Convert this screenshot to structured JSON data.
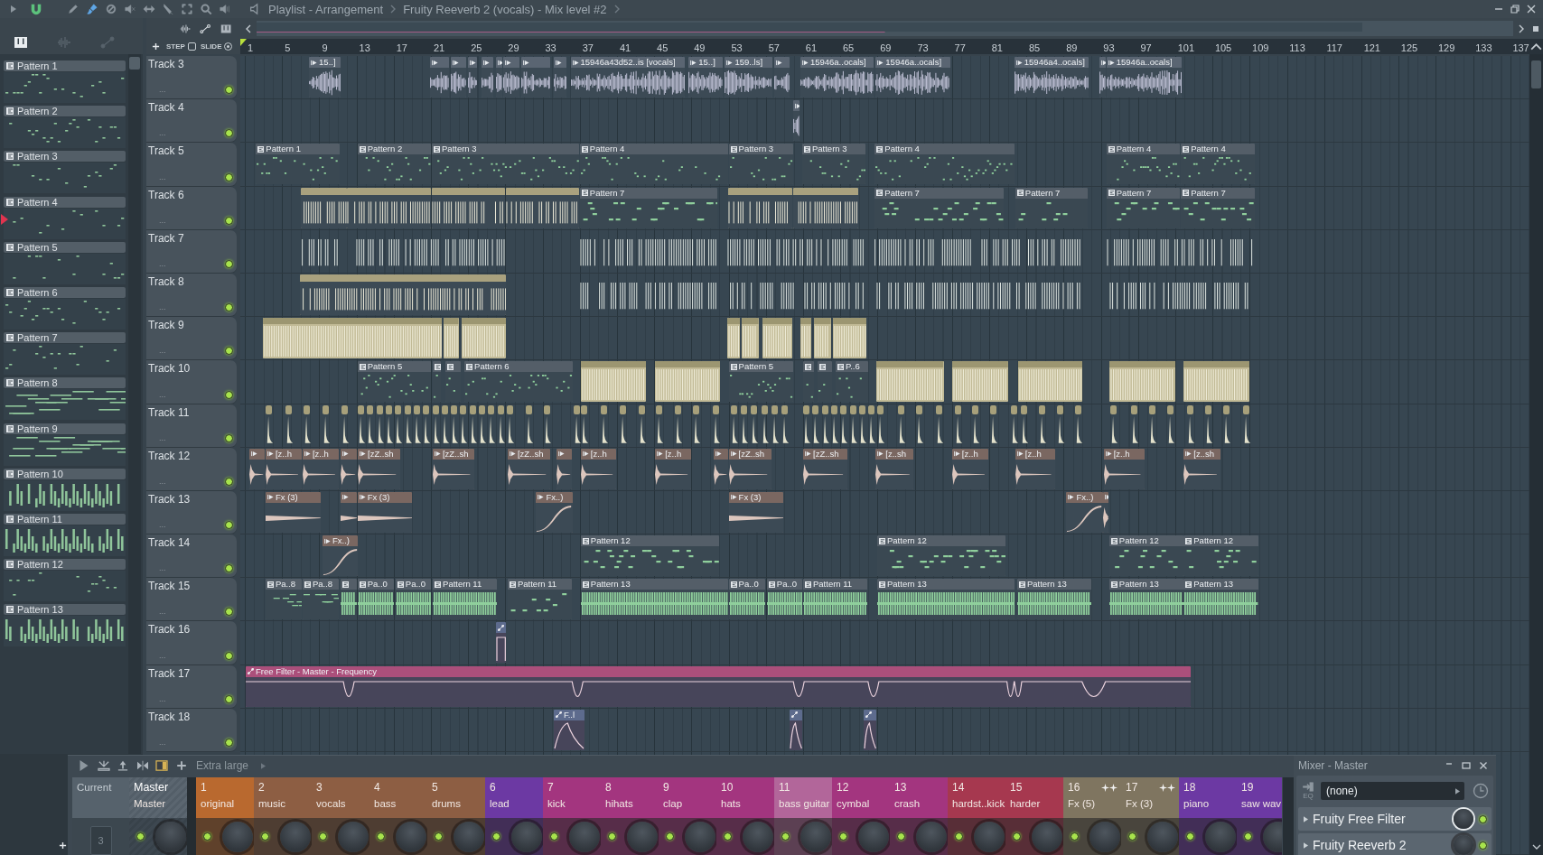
{
  "title_bar": {
    "snap": {
      "on": true
    },
    "tools": [
      {
        "selected": false
      },
      {
        "selected": true
      },
      {
        "selected": false
      },
      {
        "selected": false
      },
      {
        "selected": false
      },
      {
        "selected": false
      },
      {
        "selected": false
      },
      {
        "selected": false
      },
      {
        "selected": false
      }
    ],
    "breadcrumbs": [
      "Playlist - Arrangement",
      "Fruity Reeverb 2 (vocals) - Mix level #2"
    ]
  },
  "browser": {
    "filters": [
      {
        "selected": true
      },
      {
        "selected": false
      },
      {
        "selected": false
      }
    ],
    "patterns": [
      {
        "name": "Pattern 1",
        "selected": false
      },
      {
        "name": "Pattern 2",
        "selected": false
      },
      {
        "name": "Pattern 3",
        "selected": false
      },
      {
        "name": "Pattern 4",
        "selected": true
      },
      {
        "name": "Pattern 5",
        "selected": false
      },
      {
        "name": "Pattern 6",
        "selected": false
      },
      {
        "name": "Pattern 7",
        "selected": false
      },
      {
        "name": "Pattern 8",
        "selected": false
      },
      {
        "name": "Pattern 9",
        "selected": false
      },
      {
        "name": "Pattern 10",
        "selected": false
      },
      {
        "name": "Pattern 11",
        "selected": false
      },
      {
        "name": "Pattern 12",
        "selected": false
      },
      {
        "name": "Pattern 13",
        "selected": false
      }
    ]
  },
  "playlist": {
    "step": {
      "label": "STEP",
      "on": false
    },
    "slide": {
      "label": "SLIDE",
      "on": true
    },
    "ruler": [
      "1",
      "5",
      "9",
      "13",
      "17",
      "21",
      "25",
      "29",
      "33",
      "37",
      "41",
      "45",
      "49",
      "53",
      "57",
      "61",
      "65",
      "69",
      "73",
      "77",
      "81",
      "85",
      "89",
      "93",
      "97",
      "101",
      "105",
      "109",
      "113",
      "117",
      "121",
      "125",
      "129",
      "133",
      "137"
    ],
    "tracks": [
      {
        "name": "Track 3",
        "more": "...",
        "on": true,
        "clips": [
          {
            "kind": "audio",
            "label": "15..]"
          },
          {
            "kind": "audio"
          },
          {
            "kind": "audio"
          },
          {
            "kind": "audio"
          },
          {
            "kind": "audio"
          },
          {
            "kind": "audio"
          },
          {
            "kind": "audio"
          },
          {
            "kind": "audio"
          },
          {
            "kind": "audio"
          },
          {
            "kind": "audio",
            "label": "15946a43d52..is [vocals]"
          },
          {
            "kind": "audio",
            "label": "15..]"
          },
          {
            "kind": "audio",
            "label": "159..ls]"
          },
          {
            "kind": "audio"
          },
          {
            "kind": "audio",
            "label": "15946a..ocals]"
          },
          {
            "kind": "audio",
            "label": "15946a..ocals]"
          },
          {
            "kind": "audio",
            "label": "15946a4..ocals]"
          },
          {
            "kind": "audio"
          },
          {
            "kind": "audio",
            "label": "15946a..ocals]"
          }
        ]
      },
      {
        "name": "Track 4",
        "more": "...",
        "on": true,
        "clips": [
          {
            "kind": "audio"
          }
        ]
      },
      {
        "name": "Track 5",
        "more": "...",
        "on": true,
        "clips": [
          {
            "kind": "pattern",
            "label": "Pattern 1"
          },
          {
            "kind": "pattern",
            "label": "Pattern 2"
          },
          {
            "kind": "pattern",
            "label": "Pattern 3"
          },
          {
            "kind": "pattern",
            "label": "Pattern 4"
          },
          {
            "kind": "pattern",
            "label": "Pattern 3"
          },
          {
            "kind": "pattern",
            "label": "Pattern 3"
          },
          {
            "kind": "pattern",
            "label": "Pattern 4"
          },
          {
            "kind": "pattern",
            "label": "Pattern 4"
          },
          {
            "kind": "pattern",
            "label": "Pattern 4"
          }
        ]
      },
      {
        "name": "Track 6",
        "more": "...",
        "on": true,
        "clips": [
          {
            "kind": "beat"
          },
          {
            "kind": "beat"
          },
          {
            "kind": "beat"
          },
          {
            "kind": "beat"
          },
          {
            "kind": "pattern",
            "label": "Pattern 7"
          },
          {
            "kind": "beat"
          },
          {
            "kind": "beat"
          },
          {
            "kind": "pattern",
            "label": "Pattern 7"
          },
          {
            "kind": "pattern",
            "label": "Pattern 7"
          },
          {
            "kind": "pattern",
            "label": "Pattern 7"
          },
          {
            "kind": "pattern",
            "label": "Pattern 7"
          }
        ]
      },
      {
        "name": "Track 7",
        "more": "...",
        "on": true,
        "clips": [
          {
            "kind": "hits"
          },
          {
            "kind": "hits"
          },
          {
            "kind": "hits"
          },
          {
            "kind": "hits"
          },
          {
            "kind": "hits"
          },
          {
            "kind": "hits"
          },
          {
            "kind": "hits"
          }
        ]
      },
      {
        "name": "Track 8",
        "more": "...",
        "on": true,
        "clips": [
          {
            "kind": "beat"
          },
          {
            "kind": "hits"
          },
          {
            "kind": "hits"
          },
          {
            "kind": "hits"
          },
          {
            "kind": "hits"
          }
        ]
      },
      {
        "name": "Track 9",
        "more": "...",
        "on": true,
        "clips": [
          {
            "kind": "block"
          },
          {
            "kind": "block"
          },
          {
            "kind": "block"
          },
          {
            "kind": "block"
          },
          {
            "kind": "block"
          },
          {
            "kind": "block"
          },
          {
            "kind": "block"
          },
          {
            "kind": "block"
          },
          {
            "kind": "block"
          }
        ]
      },
      {
        "name": "Track 10",
        "more": "...",
        "on": true,
        "clips": [
          {
            "kind": "pattern",
            "label": "Pattern 5"
          },
          {
            "kind": "pattern"
          },
          {
            "kind": "pattern"
          },
          {
            "kind": "pattern",
            "label": "Pattern 6"
          },
          {
            "kind": "block"
          },
          {
            "kind": "block"
          },
          {
            "kind": "pattern",
            "label": "Pattern 5"
          },
          {
            "kind": "pattern"
          },
          {
            "kind": "pattern"
          },
          {
            "kind": "pattern",
            "label": "P..6"
          },
          {
            "kind": "block"
          },
          {
            "kind": "block"
          },
          {
            "kind": "block"
          },
          {
            "kind": "block"
          },
          {
            "kind": "block"
          }
        ]
      },
      {
        "name": "Track 11",
        "more": "...",
        "on": true,
        "clips": [
          {
            "kind": "kick"
          },
          {
            "kind": "kick"
          },
          {
            "kind": "kick"
          },
          {
            "kind": "kick"
          },
          {
            "kind": "kick"
          },
          {
            "kind": "kick"
          },
          {
            "kind": "kick"
          },
          {
            "kind": "kick"
          },
          {
            "kind": "kick"
          },
          {
            "kind": "kick"
          },
          {
            "kind": "kick"
          },
          {
            "kind": "kick"
          },
          {
            "kind": "kick"
          },
          {
            "kind": "kick"
          },
          {
            "kind": "kick"
          },
          {
            "kind": "kick"
          },
          {
            "kind": "kick"
          },
          {
            "kind": "kick"
          },
          {
            "kind": "kick"
          },
          {
            "kind": "kick"
          },
          {
            "kind": "kick"
          },
          {
            "kind": "kick"
          },
          {
            "kind": "kick"
          },
          {
            "kind": "kick"
          },
          {
            "kind": "kick"
          },
          {
            "kind": "kick"
          },
          {
            "kind": "kick"
          },
          {
            "kind": "kick"
          },
          {
            "kind": "kick"
          },
          {
            "kind": "kick"
          },
          {
            "kind": "kick"
          },
          {
            "kind": "kick"
          },
          {
            "kind": "kick"
          },
          {
            "kind": "kick"
          },
          {
            "kind": "kick"
          },
          {
            "kind": "kick"
          },
          {
            "kind": "kick"
          },
          {
            "kind": "kick"
          },
          {
            "kind": "kick"
          },
          {
            "kind": "kick"
          },
          {
            "kind": "kick"
          },
          {
            "kind": "kick"
          },
          {
            "kind": "kick"
          },
          {
            "kind": "kick"
          },
          {
            "kind": "kick"
          },
          {
            "kind": "kick"
          },
          {
            "kind": "kick"
          },
          {
            "kind": "kick"
          },
          {
            "kind": "kick"
          },
          {
            "kind": "kick"
          },
          {
            "kind": "kick"
          },
          {
            "kind": "kick"
          },
          {
            "kind": "kick"
          },
          {
            "kind": "kick"
          },
          {
            "kind": "kick"
          },
          {
            "kind": "kick"
          },
          {
            "kind": "kick"
          },
          {
            "kind": "kick"
          },
          {
            "kind": "kick"
          },
          {
            "kind": "kick"
          },
          {
            "kind": "kick"
          },
          {
            "kind": "kick"
          },
          {
            "kind": "kick"
          },
          {
            "kind": "kick"
          },
          {
            "kind": "kick"
          },
          {
            "kind": "kick"
          },
          {
            "kind": "kick"
          }
        ]
      },
      {
        "name": "Track 12",
        "more": "...",
        "on": true,
        "clips": [
          {
            "kind": "oneshot"
          },
          {
            "kind": "oneshot",
            "label": "[z..h"
          },
          {
            "kind": "oneshot",
            "label": "[z..h"
          },
          {
            "kind": "oneshot"
          },
          {
            "kind": "oneshot",
            "label": "[zZ..sh"
          },
          {
            "kind": "oneshot",
            "label": "[zZ..sh"
          },
          {
            "kind": "oneshot",
            "label": "[zZ..sh"
          },
          {
            "kind": "oneshot"
          },
          {
            "kind": "oneshot",
            "label": "[z..h"
          },
          {
            "kind": "oneshot",
            "label": "[z..h"
          },
          {
            "kind": "oneshot"
          },
          {
            "kind": "oneshot",
            "label": "[zZ..sh"
          },
          {
            "kind": "oneshot",
            "label": "[zZ..sh"
          },
          {
            "kind": "oneshot",
            "label": "[z..sh"
          },
          {
            "kind": "oneshot",
            "label": "[z..h"
          },
          {
            "kind": "oneshot",
            "label": "[z..h"
          },
          {
            "kind": "oneshot",
            "label": "[z..h"
          },
          {
            "kind": "oneshot",
            "label": "[z..sh"
          }
        ]
      },
      {
        "name": "Track 13",
        "more": "...",
        "on": true,
        "clips": [
          {
            "kind": "oneshot",
            "label": "Fx (3)"
          },
          {
            "kind": "oneshot"
          },
          {
            "kind": "oneshot",
            "label": "Fx (3)"
          },
          {
            "kind": "oneshot",
            "label": "Fx..)"
          },
          {
            "kind": "oneshot",
            "label": "Fx (3)"
          },
          {
            "kind": "oneshot",
            "label": "Fx..)"
          },
          {
            "kind": "oneshot"
          }
        ]
      },
      {
        "name": "Track 14",
        "more": "...",
        "on": true,
        "clips": [
          {
            "kind": "oneshot",
            "label": "Fx..)"
          },
          {
            "kind": "pattern",
            "label": "Pattern 12"
          },
          {
            "kind": "pattern",
            "label": "Pattern 12"
          },
          {
            "kind": "pattern",
            "label": "Pattern 12"
          },
          {
            "kind": "pattern",
            "label": "Pattern 12"
          }
        ]
      },
      {
        "name": "Track 15",
        "more": "...",
        "on": true,
        "clips": [
          {
            "kind": "pattern",
            "label": "Pa..8"
          },
          {
            "kind": "pattern",
            "label": "Pa..8"
          },
          {
            "kind": "pattern"
          },
          {
            "kind": "pattern",
            "label": "Pa..0"
          },
          {
            "kind": "pattern",
            "label": "Pa..0"
          },
          {
            "kind": "pattern",
            "label": "Pattern 11"
          },
          {
            "kind": "pattern",
            "label": "Pattern 11"
          },
          {
            "kind": "pattern",
            "label": "Pattern 13"
          },
          {
            "kind": "pattern",
            "label": "Pa..0"
          },
          {
            "kind": "pattern",
            "label": "Pa..0"
          },
          {
            "kind": "pattern",
            "label": "Pattern 11"
          },
          {
            "kind": "pattern",
            "label": "Pattern 13"
          },
          {
            "kind": "pattern",
            "label": "Pattern 13"
          },
          {
            "kind": "pattern",
            "label": "Pattern 13"
          },
          {
            "kind": "pattern",
            "label": "Pattern 13"
          }
        ]
      },
      {
        "name": "Track 16",
        "more": "...",
        "on": true,
        "clips": [
          {
            "kind": "automation",
            "color": "#5d6b8d"
          }
        ]
      },
      {
        "name": "Track 17",
        "more": "...",
        "on": true,
        "clips": [
          {
            "kind": "automation",
            "color": "#ab4f7b",
            "label": "Free Filter - Master - Frequency"
          }
        ]
      },
      {
        "name": "Track 18",
        "more": "...",
        "on": true,
        "clips": [
          {
            "kind": "automation",
            "color": "#5d6b8d",
            "label": "F..l"
          },
          {
            "kind": "automation",
            "color": "#5d6b8d"
          },
          {
            "kind": "automation",
            "color": "#5d6b8d"
          }
        ]
      }
    ]
  },
  "mixer": {
    "size": "Extra large",
    "current": {
      "label": "Current",
      "value": "3"
    },
    "master": {
      "name": "Master",
      "label": "Master",
      "on": true
    },
    "channels": [
      {
        "number": "1",
        "name": "original",
        "color": "#b9692f",
        "on": true,
        "sparkle": false
      },
      {
        "number": "2",
        "name": "music",
        "color": "#8d5e43",
        "on": true,
        "sparkle": false
      },
      {
        "number": "3",
        "name": "vocals",
        "color": "#8d5e43",
        "on": true,
        "sparkle": false
      },
      {
        "number": "4",
        "name": "bass",
        "color": "#8d5e43",
        "on": true,
        "sparkle": false
      },
      {
        "number": "5",
        "name": "drums",
        "color": "#8d5e43",
        "on": true,
        "sparkle": false
      },
      {
        "number": "6",
        "name": "lead",
        "color": "#6c39a3",
        "on": true,
        "sparkle": false
      },
      {
        "number": "7",
        "name": "kick",
        "color": "#a3357f",
        "on": true,
        "sparkle": false
      },
      {
        "number": "8",
        "name": "hihats",
        "color": "#a3357f",
        "on": true,
        "sparkle": false
      },
      {
        "number": "9",
        "name": "clap",
        "color": "#a3357f",
        "on": true,
        "sparkle": false
      },
      {
        "number": "10",
        "name": "hats",
        "color": "#a3357f",
        "on": true,
        "sparkle": false
      },
      {
        "number": "11",
        "name": "bass guitar",
        "color": "#b2669a",
        "on": true,
        "sparkle": false
      },
      {
        "number": "12",
        "name": "cymbal",
        "color": "#a3357f",
        "on": true,
        "sparkle": false
      },
      {
        "number": "13",
        "name": "crash",
        "color": "#a3357f",
        "on": true,
        "sparkle": false
      },
      {
        "number": "14",
        "name": "hardst..kick",
        "color": "#a6384f",
        "on": true,
        "sparkle": false
      },
      {
        "number": "15",
        "name": "harder",
        "color": "#a6384f",
        "on": true,
        "sparkle": false
      },
      {
        "number": "16",
        "name": "Fx (5)",
        "color": "#7f7560",
        "on": true,
        "sparkle": true
      },
      {
        "number": "17",
        "name": "Fx (3)",
        "color": "#7f7560",
        "on": true,
        "sparkle": true
      },
      {
        "number": "18",
        "name": "piano",
        "color": "#6c39a3",
        "on": true,
        "sparkle": false
      },
      {
        "number": "19",
        "name": "saw wav",
        "color": "#6c39a3",
        "on": true,
        "sparkle": false
      }
    ]
  },
  "mixer_master": {
    "title": "Mixer - Master",
    "eq_label": "EQ",
    "input": "(none)",
    "effects": [
      {
        "name": "Fruity Free Filter",
        "on": true,
        "selected": true
      },
      {
        "name": "Fruity Reeverb 2",
        "on": true,
        "selected": false
      }
    ]
  }
}
